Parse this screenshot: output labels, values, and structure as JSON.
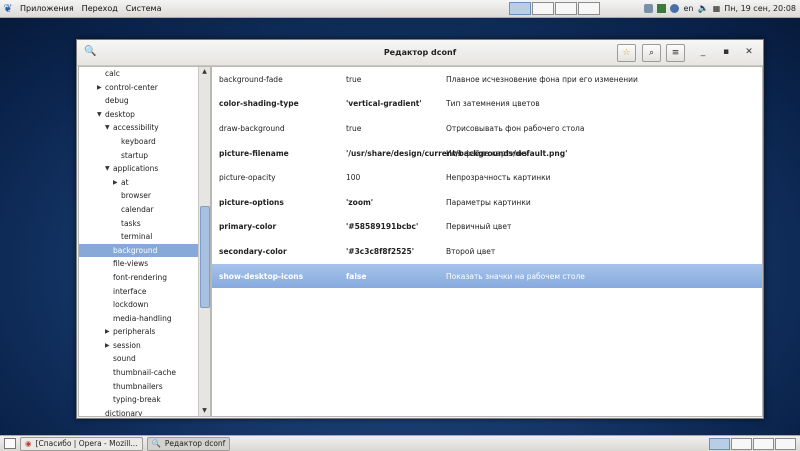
{
  "top_panel": {
    "menus": [
      "Приложения",
      "Переход",
      "Система"
    ],
    "lang": "en",
    "clock": "Пн, 19 сен, 20:08"
  },
  "window": {
    "title": "Редактор dconf"
  },
  "tree": [
    {
      "label": "calc",
      "indent": 0,
      "arrow": ""
    },
    {
      "label": "control-center",
      "indent": 0,
      "arrow": "collapsed"
    },
    {
      "label": "debug",
      "indent": 0,
      "arrow": ""
    },
    {
      "label": "desktop",
      "indent": 0,
      "arrow": "expanded"
    },
    {
      "label": "accessibility",
      "indent": 1,
      "arrow": "expanded"
    },
    {
      "label": "keyboard",
      "indent": 2,
      "arrow": ""
    },
    {
      "label": "startup",
      "indent": 2,
      "arrow": ""
    },
    {
      "label": "applications",
      "indent": 1,
      "arrow": "expanded"
    },
    {
      "label": "at",
      "indent": 2,
      "arrow": "collapsed"
    },
    {
      "label": "browser",
      "indent": 2,
      "arrow": ""
    },
    {
      "label": "calendar",
      "indent": 2,
      "arrow": ""
    },
    {
      "label": "tasks",
      "indent": 2,
      "arrow": ""
    },
    {
      "label": "terminal",
      "indent": 2,
      "arrow": ""
    },
    {
      "label": "background",
      "indent": 1,
      "arrow": "",
      "selected": true
    },
    {
      "label": "file-views",
      "indent": 1,
      "arrow": ""
    },
    {
      "label": "font-rendering",
      "indent": 1,
      "arrow": ""
    },
    {
      "label": "interface",
      "indent": 1,
      "arrow": ""
    },
    {
      "label": "lockdown",
      "indent": 1,
      "arrow": ""
    },
    {
      "label": "media-handling",
      "indent": 1,
      "arrow": ""
    },
    {
      "label": "peripherals",
      "indent": 1,
      "arrow": "collapsed"
    },
    {
      "label": "session",
      "indent": 1,
      "arrow": "collapsed"
    },
    {
      "label": "sound",
      "indent": 1,
      "arrow": ""
    },
    {
      "label": "thumbnail-cache",
      "indent": 1,
      "arrow": ""
    },
    {
      "label": "thumbnailers",
      "indent": 1,
      "arrow": ""
    },
    {
      "label": "typing-break",
      "indent": 1,
      "arrow": ""
    },
    {
      "label": "dictionary",
      "indent": 0,
      "arrow": ""
    }
  ],
  "keys": [
    {
      "name": "background-fade",
      "value": "true",
      "desc": "Плавное исчезновение фона при его изменении",
      "bold": false
    },
    {
      "name": "color-shading-type",
      "value": "'vertical-gradient'",
      "desc": "Тип затемнения цветов",
      "bold": true
    },
    {
      "name": "draw-background",
      "value": "true",
      "desc": "Отрисовывать фон рабочего стола",
      "bold": false
    },
    {
      "name": "picture-filename",
      "value": "'/usr/share/design/current/backgrounds/default.png'",
      "desc": "Имя файла картинки",
      "bold": true
    },
    {
      "name": "picture-opacity",
      "value": "100",
      "desc": "Непрозрачность картинки",
      "bold": false
    },
    {
      "name": "picture-options",
      "value": "'zoom'",
      "desc": "Параметры картинки",
      "bold": true
    },
    {
      "name": "primary-color",
      "value": "'#58589191bcbc'",
      "desc": "Первичный цвет",
      "bold": true
    },
    {
      "name": "secondary-color",
      "value": "'#3c3c8f8f2525'",
      "desc": "Второй цвет",
      "bold": true
    },
    {
      "name": "show-desktop-icons",
      "value": "false",
      "desc": "Показать значки на рабочем столе",
      "bold": true,
      "selected": true
    }
  ],
  "taskbar": [
    {
      "label": "[Спасибо | Opera - Mozill...",
      "icon": "browser-icon"
    },
    {
      "label": "Редактор dconf",
      "icon": "dconf-icon",
      "active": true
    }
  ]
}
